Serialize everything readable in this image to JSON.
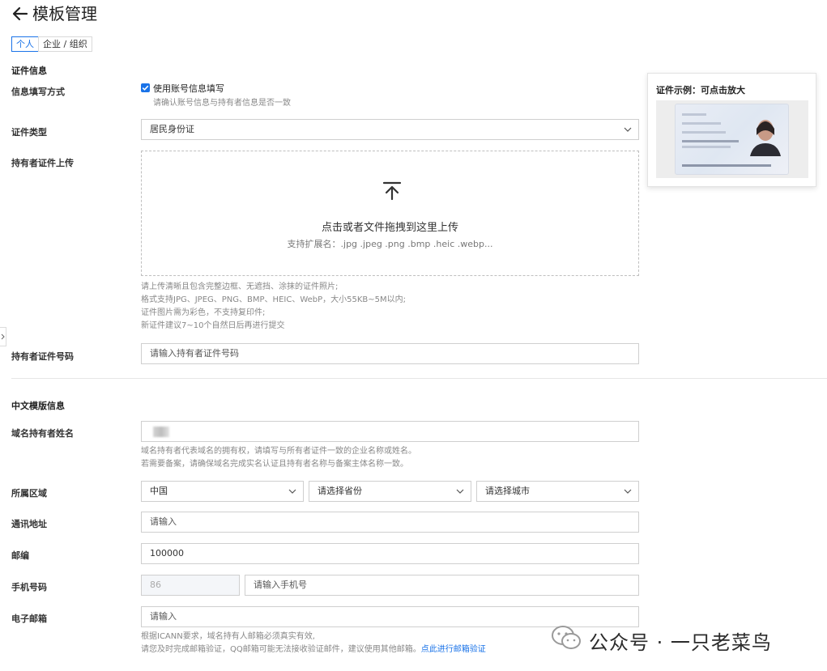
{
  "header": {
    "title": "模板管理"
  },
  "tabs": [
    {
      "label": "个人",
      "active": true
    },
    {
      "label": "企业 / 组织",
      "active": false
    }
  ],
  "cert_section": {
    "title": "证件信息",
    "fill_method": {
      "label": "信息填写方式",
      "checkbox_label": "使用账号信息填写",
      "checked": true,
      "help": "请确认账号信息与持有者信息是否一致"
    },
    "cert_type": {
      "label": "证件类型",
      "value": "居民身份证"
    },
    "upload": {
      "label": "持有者证件上传",
      "main_text": "点击或者文件拖拽到这里上传",
      "sub_text": "支持扩展名：.jpg .jpeg .png .bmp .heic .webp...",
      "help": [
        "请上传清晰且包含完整边框、无遮挡、涂抹的证件照片;",
        "格式支持JPG、JPEG、PNG、BMP、HEIC、WebP，大小55KB~5M以内;",
        "证件图片需为彩色，不支持复印件;",
        "新证件建议7~10个自然日后再进行提交"
      ]
    },
    "cert_number": {
      "label": "持有者证件号码",
      "placeholder": "请输入持有者证件号码"
    }
  },
  "tooltip": {
    "title": "证件示例：可点击放大"
  },
  "cn_section": {
    "title": "中文模版信息",
    "holder_name": {
      "label": "域名持有者姓名",
      "help": [
        "域名持有者代表域名的拥有权，请填写与所有者证件一致的企业名称或姓名。",
        "若需要备案，请确保域名完成实名认证且持有者名称与备案主体名称一致。"
      ]
    },
    "region": {
      "label": "所属区域",
      "country": "中国",
      "province_placeholder": "请选择省份",
      "city_placeholder": "请选择城市"
    },
    "address": {
      "label": "通讯地址",
      "placeholder": "请输入"
    },
    "postcode": {
      "label": "邮编",
      "value": "100000"
    },
    "phone": {
      "label": "手机号码",
      "code": "86",
      "placeholder": "请输入手机号"
    },
    "email": {
      "label": "电子邮箱",
      "placeholder": "请输入",
      "help_line1": "根据ICANN要求，域名持有人邮箱必须真实有效,",
      "help_line2": "请您及时完成邮箱验证，QQ邮箱可能无法接收验证邮件，建议使用其他邮箱。",
      "verify_link": "点此进行邮箱验证"
    }
  },
  "watermark": {
    "text": "公众号 · 一只老菜鸟"
  },
  "colors": {
    "accent": "#1a73e8",
    "border": "#cfcfcf",
    "help": "#888888"
  }
}
